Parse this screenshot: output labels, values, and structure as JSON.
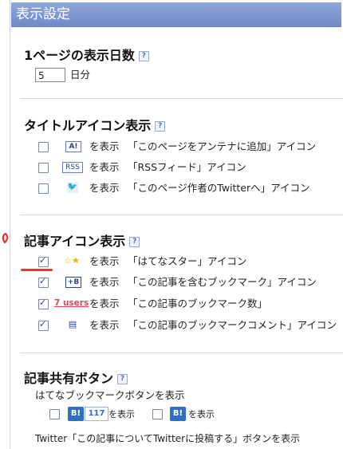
{
  "title": "表示設定",
  "help_glyph": "?",
  "days": {
    "heading": "1ページの表示日数",
    "value": "5",
    "unit": "日分"
  },
  "title_icons": {
    "heading": "タイトルアイコン表示",
    "items": [
      {
        "icon_text": "A!",
        "show": "を表示",
        "desc": "「このページをアンテナに追加」アイコン",
        "checked": false
      },
      {
        "icon_text": "RSS",
        "show": "を表示",
        "desc": "「RSSフィード」アイコン",
        "checked": false
      },
      {
        "icon_text": "🐦",
        "show": "を表示",
        "desc": "「このページ作者のTwitterへ」アイコン",
        "checked": false
      }
    ]
  },
  "article_icons": {
    "heading": "記事アイコン表示",
    "items": [
      {
        "icon_text": "☆★",
        "show": "を表示",
        "desc": "「はてなスター」アイコン",
        "checked": true
      },
      {
        "icon_text": "+B",
        "show": "を表示",
        "desc": "「この記事を含むブックマーク」アイコン",
        "checked": true
      },
      {
        "icon_text": "7 users",
        "show": "を表示",
        "desc": "「この記事のブックマーク数」",
        "checked": true
      },
      {
        "icon_text": "▤",
        "show": "を表示",
        "desc": "「この記事のブックマークコメント」アイコン",
        "checked": true
      }
    ]
  },
  "share": {
    "heading": "記事共有ボタン",
    "hatena_label": "はてなブックマークボタンを表示",
    "button1": {
      "badge": "B!",
      "count": "117",
      "show": "を表示",
      "checked": false
    },
    "button2": {
      "badge": "B!",
      "show": "を表示",
      "checked": false
    },
    "twitter_label": "Twitter「この記事についてTwitterに投稿する」ボタンを表示"
  },
  "colors": {
    "title_bar": "#7f98d0",
    "link_blue": "#3556a8",
    "users_red": "#e0474c",
    "annotation_red": "#e33333"
  }
}
